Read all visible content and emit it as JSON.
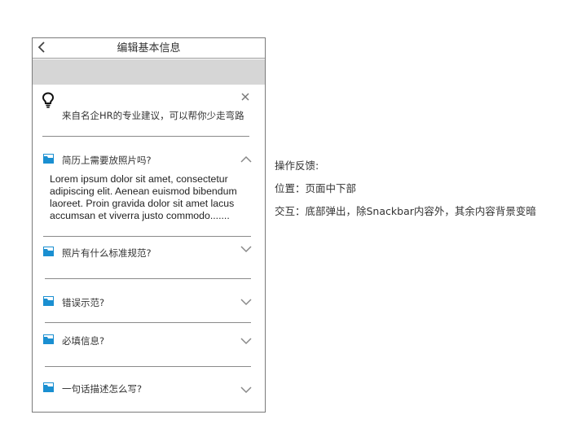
{
  "header": {
    "title": "编辑基本信息",
    "back_icon": "chevron-left-icon"
  },
  "tip": {
    "icon": "lightbulb-icon",
    "text": "来自名企HR的专业建议，可以帮你少走弯路",
    "close_icon": "close-icon"
  },
  "faq": [
    {
      "question": "简历上需要放照片吗?",
      "expanded": true,
      "answer": "Lorem ipsum dolor sit amet, consectetur adipiscing elit. Aenean euismod bibendum laoreet. Proin gravida dolor sit amet lacus accumsan et viverra justo commodo......."
    },
    {
      "question": "照片有什么标准规范?",
      "expanded": false
    },
    {
      "question": "错误示范?",
      "expanded": false
    },
    {
      "question": "必填信息?",
      "expanded": false
    },
    {
      "question": "一句话描述怎么写?",
      "expanded": false
    }
  ],
  "colors": {
    "item_icon": "#1a8fd1",
    "placeholder_bar": "#d6d6d6",
    "divider": "#8a8a8a"
  },
  "notes": {
    "feedback_label": "操作反馈:",
    "position": "位置：页面中下部",
    "interaction": "交互：底部弹出，除Snackbar内容外，其余内容背景变暗"
  }
}
